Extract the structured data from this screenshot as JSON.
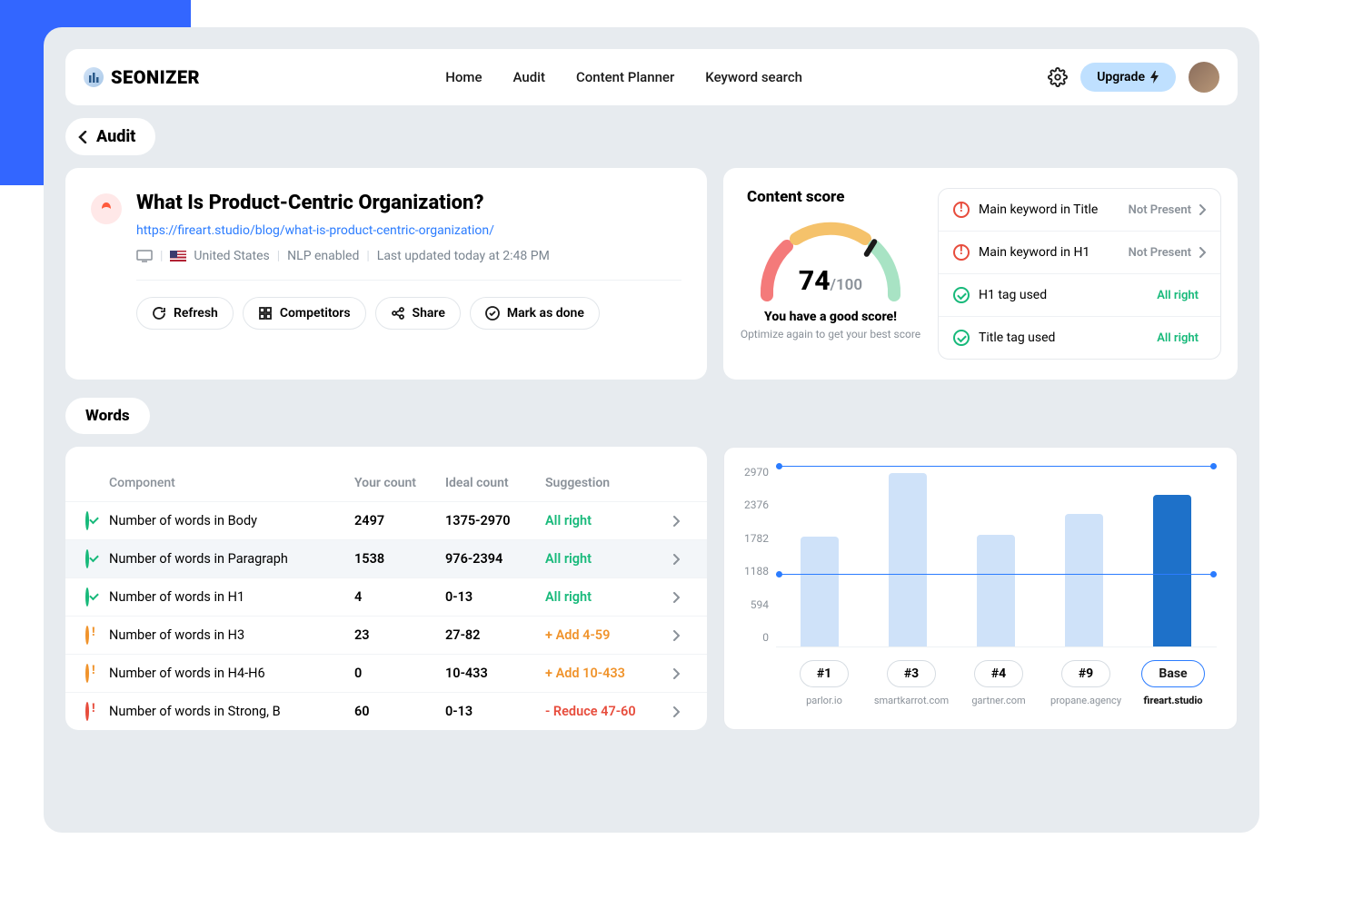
{
  "brand": "SEONIZER",
  "nav": [
    "Home",
    "Audit",
    "Content Planner",
    "Keyword search"
  ],
  "upgrade": "Upgrade",
  "crumb": "Audit",
  "page": {
    "title": "What Is Product-Centric Organization?",
    "url": "https://fireart.studio/blog/what-is-product-centric-organization/",
    "country": "United States",
    "nlp": "NLP enabled",
    "updated": "Last updated today at 2:48 PM"
  },
  "actions": {
    "refresh": "Refresh",
    "competitors": "Competitors",
    "share": "Share",
    "mark": "Mark as done"
  },
  "score": {
    "title": "Content score",
    "value": "74",
    "max": "/100",
    "msg": "You have a good score!",
    "sub": "Optimize again to get your best score"
  },
  "checks": [
    {
      "icon": "err",
      "label": "Main keyword in Title",
      "status": "Not Present",
      "cls": "st-gray",
      "chev": true
    },
    {
      "icon": "err",
      "label": "Main keyword in H1",
      "status": "Not Present",
      "cls": "st-gray",
      "chev": true
    },
    {
      "icon": "ok",
      "label": "H1 tag used",
      "status": "All right",
      "cls": "st-green",
      "chev": false
    },
    {
      "icon": "ok",
      "label": "Title tag used",
      "status": "All right",
      "cls": "st-green",
      "chev": false
    }
  ],
  "words_title": "Words",
  "thead": {
    "name": "Component",
    "your": "Your count",
    "ideal": "Ideal count",
    "sug": "Suggestion"
  },
  "rows": [
    {
      "icon": "ok",
      "name": "Number of words in Body",
      "your": "2497",
      "ideal": "1375-2970",
      "sug": "All right",
      "cls": "st-green"
    },
    {
      "icon": "ok",
      "name": "Number of words in Paragraph",
      "your": "1538",
      "ideal": "976-2394",
      "sug": "All right",
      "cls": "st-green",
      "sel": true
    },
    {
      "icon": "ok",
      "name": "Number of words in H1",
      "your": "4",
      "ideal": "0-13",
      "sug": "All right",
      "cls": "st-green"
    },
    {
      "icon": "warn",
      "name": "Number of words in H3",
      "your": "23",
      "ideal": "27-82",
      "sug": "+ Add 4-59",
      "cls": "st-orange"
    },
    {
      "icon": "warn",
      "name": "Number of words in H4-H6",
      "your": "0",
      "ideal": "10-433",
      "sug": "+ Add 10-433",
      "cls": "st-orange"
    },
    {
      "icon": "err",
      "name": "Number of words in Strong, B",
      "your": "60",
      "ideal": "0-13",
      "sug": "- Reduce 47-60",
      "cls": "st-red"
    }
  ],
  "chart_data": {
    "type": "bar",
    "ylim": [
      0,
      2970
    ],
    "yticks": [
      0,
      594,
      1188,
      1782,
      2376,
      2970
    ],
    "ref_lines": [
      2970,
      1188
    ],
    "series": [
      {
        "rank": "#1",
        "domain": "parlor.io",
        "value": 1800,
        "highlight": false
      },
      {
        "rank": "#3",
        "domain": "smartkarrot.com",
        "value": 2850,
        "highlight": false
      },
      {
        "rank": "#4",
        "domain": "gartner.com",
        "value": 1840,
        "highlight": false
      },
      {
        "rank": "#9",
        "domain": "propane.agency",
        "value": 2180,
        "highlight": false
      },
      {
        "rank": "Base",
        "domain": "fireart.studio",
        "value": 2497,
        "highlight": true
      }
    ]
  }
}
